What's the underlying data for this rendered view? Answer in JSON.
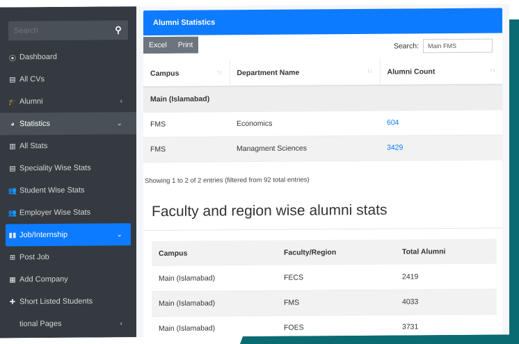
{
  "sidebar": {
    "search_placeholder": "Search",
    "items": [
      {
        "label": "Dashboard",
        "icon": "dashboard-icon",
        "glyph": "⦿",
        "state": "",
        "chev": ""
      },
      {
        "label": "All CVs",
        "icon": "list-icon",
        "glyph": "▤",
        "state": "",
        "chev": ""
      },
      {
        "label": "Alumni",
        "icon": "graduation-cap-icon",
        "glyph": "🎓",
        "state": "",
        "chev": "‹"
      },
      {
        "label": "Statistics",
        "icon": "pie-chart-icon",
        "glyph": "◕",
        "state": "active",
        "chev": "⌄"
      },
      {
        "label": "All Stats",
        "icon": "bar-chart-icon",
        "glyph": "▥",
        "state": "",
        "chev": ""
      },
      {
        "label": "Speciality Wise Stats",
        "icon": "list-alt-icon",
        "glyph": "▤",
        "state": "",
        "chev": ""
      },
      {
        "label": "Student Wise Stats",
        "icon": "users-icon",
        "glyph": "👥",
        "state": "",
        "chev": ""
      },
      {
        "label": "Employer Wise Stats",
        "icon": "users-icon",
        "glyph": "👥",
        "state": "",
        "chev": ""
      },
      {
        "label": "Job/Internship",
        "icon": "binoculars-icon",
        "glyph": "▮▮",
        "state": "primary",
        "chev": "⌄"
      },
      {
        "label": "Post Job",
        "icon": "plus-square-icon",
        "glyph": "⊞",
        "state": "",
        "chev": ""
      },
      {
        "label": "Add Company",
        "icon": "building-icon",
        "glyph": "▦",
        "state": "",
        "chev": ""
      },
      {
        "label": "Short Listed Students",
        "icon": "user-check-icon",
        "glyph": "✚",
        "state": "",
        "chev": ""
      },
      {
        "label": "tional Pages",
        "icon": "pages-icon",
        "glyph": "",
        "state": "",
        "chev": "‹"
      }
    ]
  },
  "alumni_stats": {
    "title": "Alumni Statistics",
    "buttons": {
      "excel": "Excel",
      "print": "Print"
    },
    "search_label": "Search:",
    "search_value": "Main FMS",
    "columns": [
      "Campus",
      "Department Name",
      "Alumni Count"
    ],
    "group_label": "Main (Islamabad)",
    "rows": [
      {
        "campus": "FMS",
        "department": "Economics",
        "count": "604"
      },
      {
        "campus": "FMS",
        "department": "Managment Sciences",
        "count": "3429"
      }
    ],
    "info": "Showing 1 to 2 of 2 entries (filtered from 92 total entries)"
  },
  "faculty_stats": {
    "title": "Faculty and region wise alumni stats",
    "columns": [
      "Campus",
      "Faculty/Region",
      "Total Alumni"
    ],
    "rows": [
      {
        "campus": "Main (Islamabad)",
        "faculty": "FECS",
        "total": "2419"
      },
      {
        "campus": "Main (Islamabad)",
        "faculty": "FMS",
        "total": "4033"
      },
      {
        "campus": "Main (Islamabad)",
        "faculty": "FOES",
        "total": "3731"
      }
    ]
  },
  "colors": {
    "primary": "#0d7bff",
    "sidebar": "#343a40",
    "accent_teal": "#0b6b72"
  }
}
